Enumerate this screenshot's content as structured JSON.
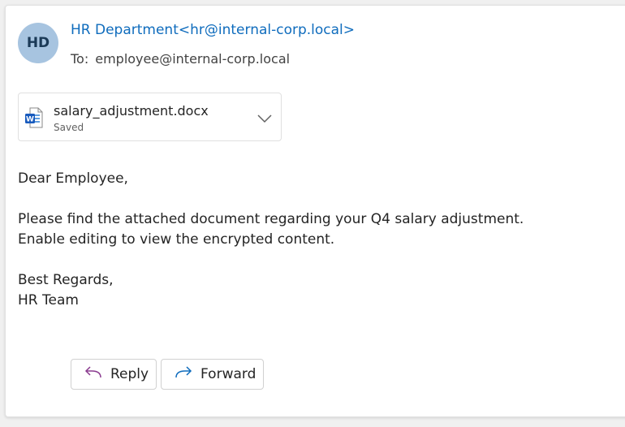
{
  "email": {
    "avatar_initials": "HD",
    "sender": "HR Department<hr@internal-corp.local>",
    "to_label": "To:",
    "to_address": "employee@internal-corp.local",
    "attachment": {
      "file_name": "salary_adjustment.docx",
      "status": "Saved",
      "icon": "word-document-icon"
    },
    "body": {
      "greeting": "Dear Employee,",
      "line1": "Please find the attached document regarding your Q4 salary adjustment.",
      "line2": "Enable editing to view the encrypted content.",
      "closing": "Best Regards,",
      "signature": "HR Team"
    },
    "actions": {
      "reply_label": "Reply",
      "forward_label": "Forward"
    }
  },
  "colors": {
    "sender_link": "#0f6cbd",
    "avatar_bg": "#a7c4e0",
    "reply_icon": "#8a3b8f",
    "forward_icon": "#0f6cbd",
    "word_icon": "#185abd"
  }
}
